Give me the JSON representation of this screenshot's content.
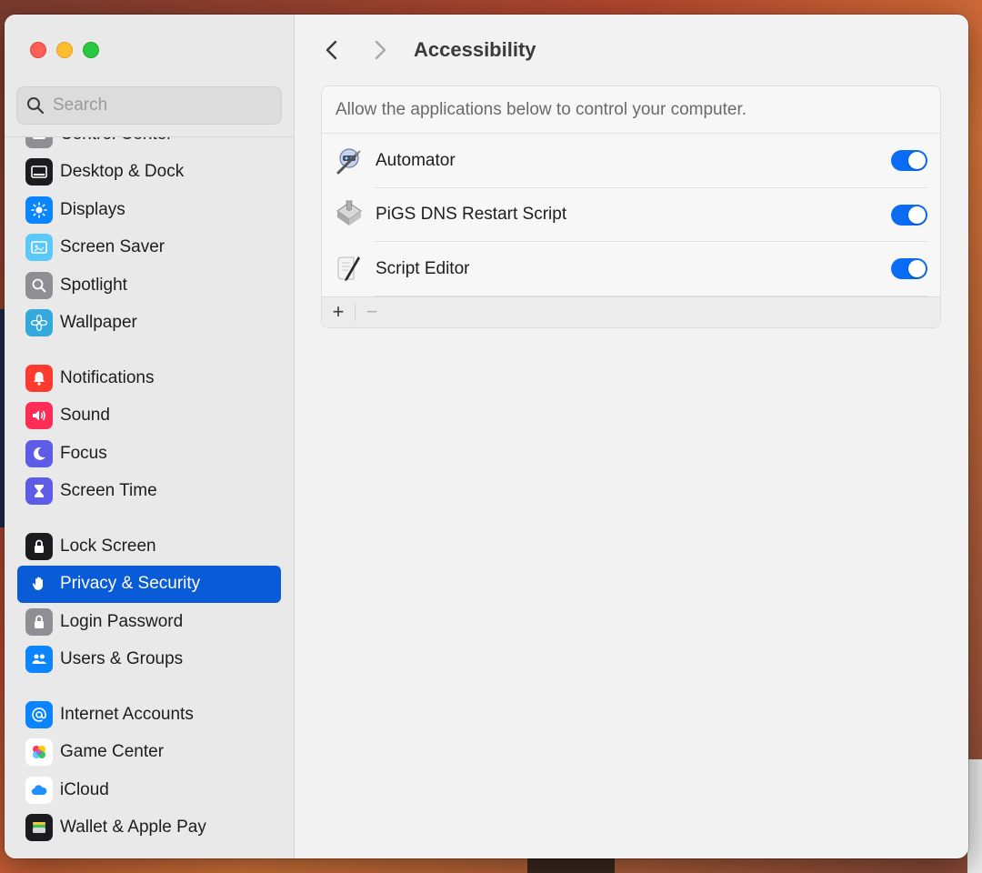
{
  "search": {
    "placeholder": "Search"
  },
  "sidebar": {
    "items": [
      {
        "label": "Control Center",
        "icon": "control-center-icon",
        "color": "#8e8e93"
      },
      {
        "label": "Desktop & Dock",
        "icon": "dock-icon",
        "color": "#1c1c1e"
      },
      {
        "label": "Displays",
        "icon": "sun-icon",
        "color": "#0a84ff"
      },
      {
        "label": "Screen Saver",
        "icon": "screen-saver-icon",
        "color": "#5ac8fa"
      },
      {
        "label": "Spotlight",
        "icon": "magnifier-icon",
        "color": "#8e8e93"
      },
      {
        "label": "Wallpaper",
        "icon": "flower-icon",
        "color": "#34aadc"
      },
      {
        "label": "Notifications",
        "icon": "bell-icon",
        "color": "#ff3b30"
      },
      {
        "label": "Sound",
        "icon": "speaker-icon",
        "color": "#ff2d55"
      },
      {
        "label": "Focus",
        "icon": "moon-icon",
        "color": "#5e5ce6"
      },
      {
        "label": "Screen Time",
        "icon": "hourglass-icon",
        "color": "#5e5ce6"
      },
      {
        "label": "Lock Screen",
        "icon": "lock-icon",
        "color": "#1c1c1e"
      },
      {
        "label": "Privacy & Security",
        "icon": "hand-icon",
        "color": "#0a84ff"
      },
      {
        "label": "Login Password",
        "icon": "padlock-icon",
        "color": "#8e8e93"
      },
      {
        "label": "Users & Groups",
        "icon": "users-icon",
        "color": "#0a84ff"
      },
      {
        "label": "Internet Accounts",
        "icon": "at-icon",
        "color": "#0a84ff"
      },
      {
        "label": "Game Center",
        "icon": "game-center-icon",
        "color": "#ffffff"
      },
      {
        "label": "iCloud",
        "icon": "cloud-icon",
        "color": "#ffffff"
      },
      {
        "label": "Wallet & Apple Pay",
        "icon": "wallet-icon",
        "color": "#1c1c1e"
      }
    ],
    "selected": "Privacy & Security"
  },
  "header": {
    "title": "Accessibility"
  },
  "panel": {
    "description": "Allow the applications below to control your computer.",
    "apps": [
      {
        "name": "Automator",
        "icon": "automator-icon",
        "enabled": true
      },
      {
        "name": "PiGS DNS Restart Script",
        "icon": "script-applet-icon",
        "enabled": true
      },
      {
        "name": "Script Editor",
        "icon": "script-editor-icon",
        "enabled": true
      }
    ],
    "add_label": "+",
    "remove_label": "−"
  },
  "colors": {
    "accent": "#0a5bd8",
    "toggle_on": "#0a6cf5"
  }
}
